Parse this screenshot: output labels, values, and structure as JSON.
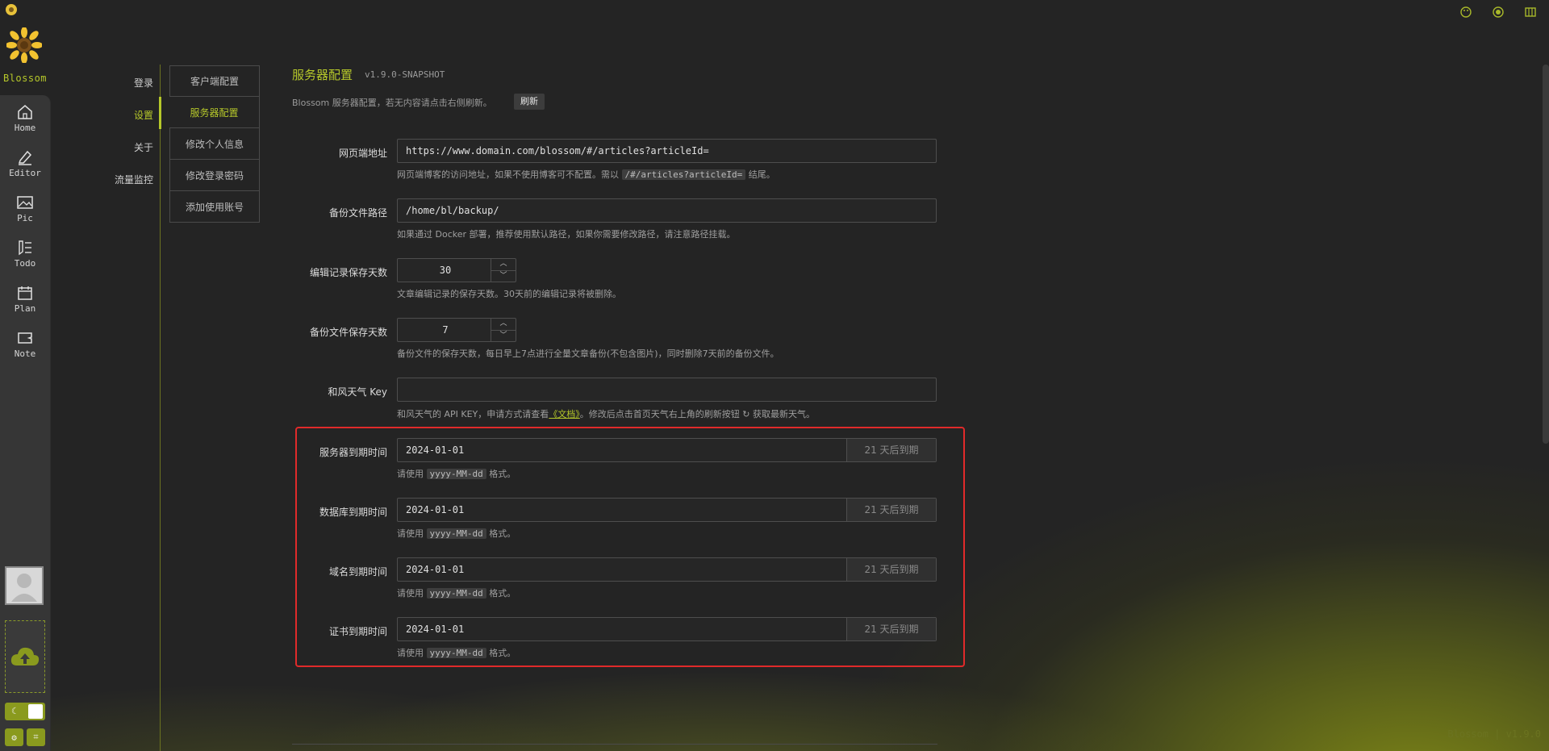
{
  "app": {
    "name": "Blossom",
    "footer_version": "Blossom | v1.9.0"
  },
  "top_icons": [
    "palette-icon",
    "record-icon",
    "columns-icon"
  ],
  "rail": {
    "items": [
      {
        "label": "Home",
        "icon": "home-icon"
      },
      {
        "label": "Editor",
        "icon": "editor-icon"
      },
      {
        "label": "Pic",
        "icon": "picture-icon"
      },
      {
        "label": "Todo",
        "icon": "todo-icon"
      },
      {
        "label": "Plan",
        "icon": "calendar-icon"
      },
      {
        "label": "Note",
        "icon": "note-icon"
      }
    ]
  },
  "menu1": {
    "items": [
      "登录",
      "设置",
      "关于",
      "流量监控"
    ],
    "active": "设置"
  },
  "menu2": {
    "items": [
      "客户端配置",
      "服务器配置",
      "修改个人信息",
      "修改登录密码",
      "添加使用账号"
    ],
    "active": "服务器配置"
  },
  "page": {
    "title": "服务器配置",
    "version": "v1.9.0-SNAPSHOT",
    "desc": "Blossom 服务器配置，若无内容请点击右侧刷新。",
    "refresh_label": "刷新"
  },
  "form": {
    "web_url": {
      "label": "网页端地址",
      "value": "https://www.domain.com/blossom/#/articles?articleId=",
      "hint_pre": "网页端博客的访问地址，如果不使用博客可不配置。需以",
      "hint_code": "/#/articles?articleId=",
      "hint_post": "结尾。"
    },
    "backup_path": {
      "label": "备份文件路径",
      "value": "/home/bl/backup/",
      "hint": "如果通过 Docker 部署，推荐使用默认路径，如果你需要修改路径，请注意路径挂载。"
    },
    "edit_days": {
      "label": "编辑记录保存天数",
      "value": "30",
      "hint": "文章编辑记录的保存天数。30天前的编辑记录将被删除。"
    },
    "backup_days": {
      "label": "备份文件保存天数",
      "value": "7",
      "hint": "备份文件的保存天数，每日早上7点进行全量文章备份(不包含图片)，同时删除7天前的备份文件。"
    },
    "weather_key": {
      "label": "和风天气 Key",
      "value": "",
      "hint_pre": "和风天气的 API KEY，申请方式请查看",
      "hint_link": "《文档》",
      "hint_mid": "。修改后点击首页天气右上角的刷新按钮",
      "hint_post": "获取最新天气。"
    },
    "expiry": [
      {
        "label": "服务器到期时间",
        "value": "2024-01-01",
        "suffix": "21 天后到期"
      },
      {
        "label": "数据库到期时间",
        "value": "2024-01-01",
        "suffix": "21 天后到期"
      },
      {
        "label": "域名到期时间",
        "value": "2024-01-01",
        "suffix": "21 天后到期"
      },
      {
        "label": "证书到期时间",
        "value": "2024-01-01",
        "suffix": "21 天后到期"
      }
    ],
    "expiry_hint_pre": "请使用",
    "expiry_hint_code": "yyyy-MM-dd",
    "expiry_hint_post": "格式。"
  },
  "colors": {
    "accent": "#b6c82a",
    "highlight": "#e02a2a",
    "background": "#242424"
  }
}
